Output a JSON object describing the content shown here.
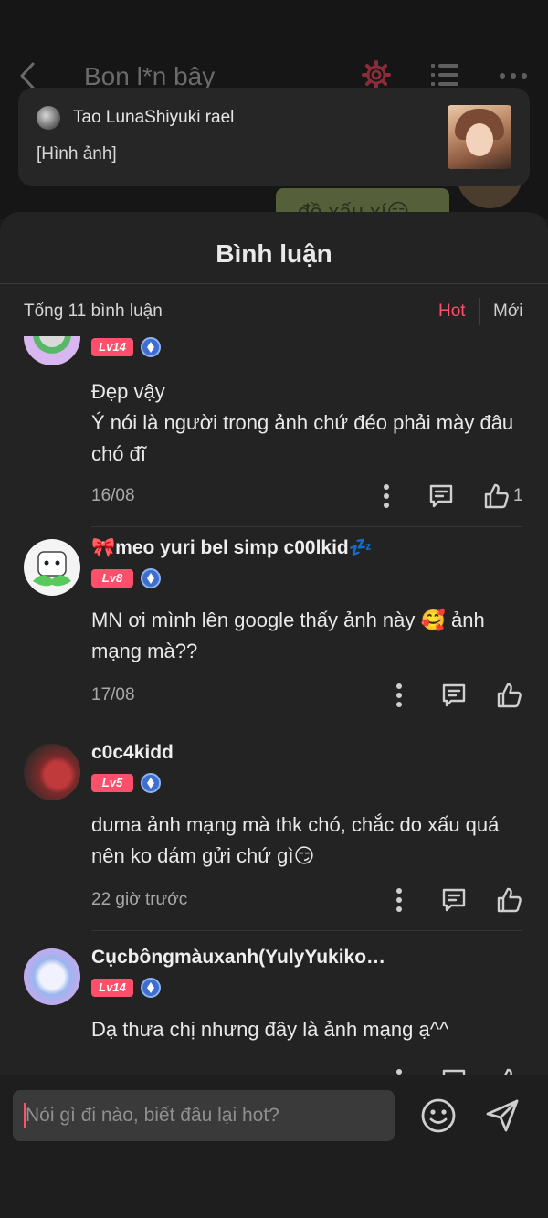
{
  "background_chat": {
    "title": "Bon l*n bây",
    "bubble_text": "đồ xấu xí😏",
    "icons": {
      "back": "chevron-left-icon",
      "settings": "gear-icon",
      "list": "list-icon",
      "more": "more-horizontal-icon"
    },
    "accent_color": "#ff4f6b"
  },
  "notification": {
    "sender": "Tao LunaShiyuki rael",
    "text": "[Hình ảnh]"
  },
  "sheet": {
    "title": "Bình luận",
    "total": "Tổng 11 bình luận",
    "sort_hot": "Hot",
    "sort_new": "Mới"
  },
  "comments": [
    {
      "username": "",
      "level": "Lv14",
      "text": "Đẹp vậy\nÝ nói là người trong ảnh chứ đéo phải mày đâu chó đĩ",
      "date": "16/08",
      "likes": "1"
    },
    {
      "username": "🎀meo yuri bel simp c00lkid💤",
      "level": "Lv8",
      "text": "MN ơi mình lên google thấy ảnh này 🥰 ảnh mạng mà??",
      "date": "17/08",
      "likes": ""
    },
    {
      "username": "c0c4kidd",
      "level": "Lv5",
      "text": "duma ảnh mạng mà thk chó, chắc do xấu quá nên ko dám gửi chứ gì😏",
      "date": "22 giờ trước",
      "likes": ""
    },
    {
      "username": "Cụcbôngmàuxanh(YulyYukiko…",
      "level": "Lv14",
      "text": "Dạ thưa chị nhưng đây là ảnh mạng ạ^^",
      "date": "",
      "likes": ""
    }
  ],
  "input": {
    "placeholder": "Nói gì đi nào, biết đâu lại hot?",
    "emoji_icon": "smile-icon",
    "send_icon": "send-icon"
  }
}
